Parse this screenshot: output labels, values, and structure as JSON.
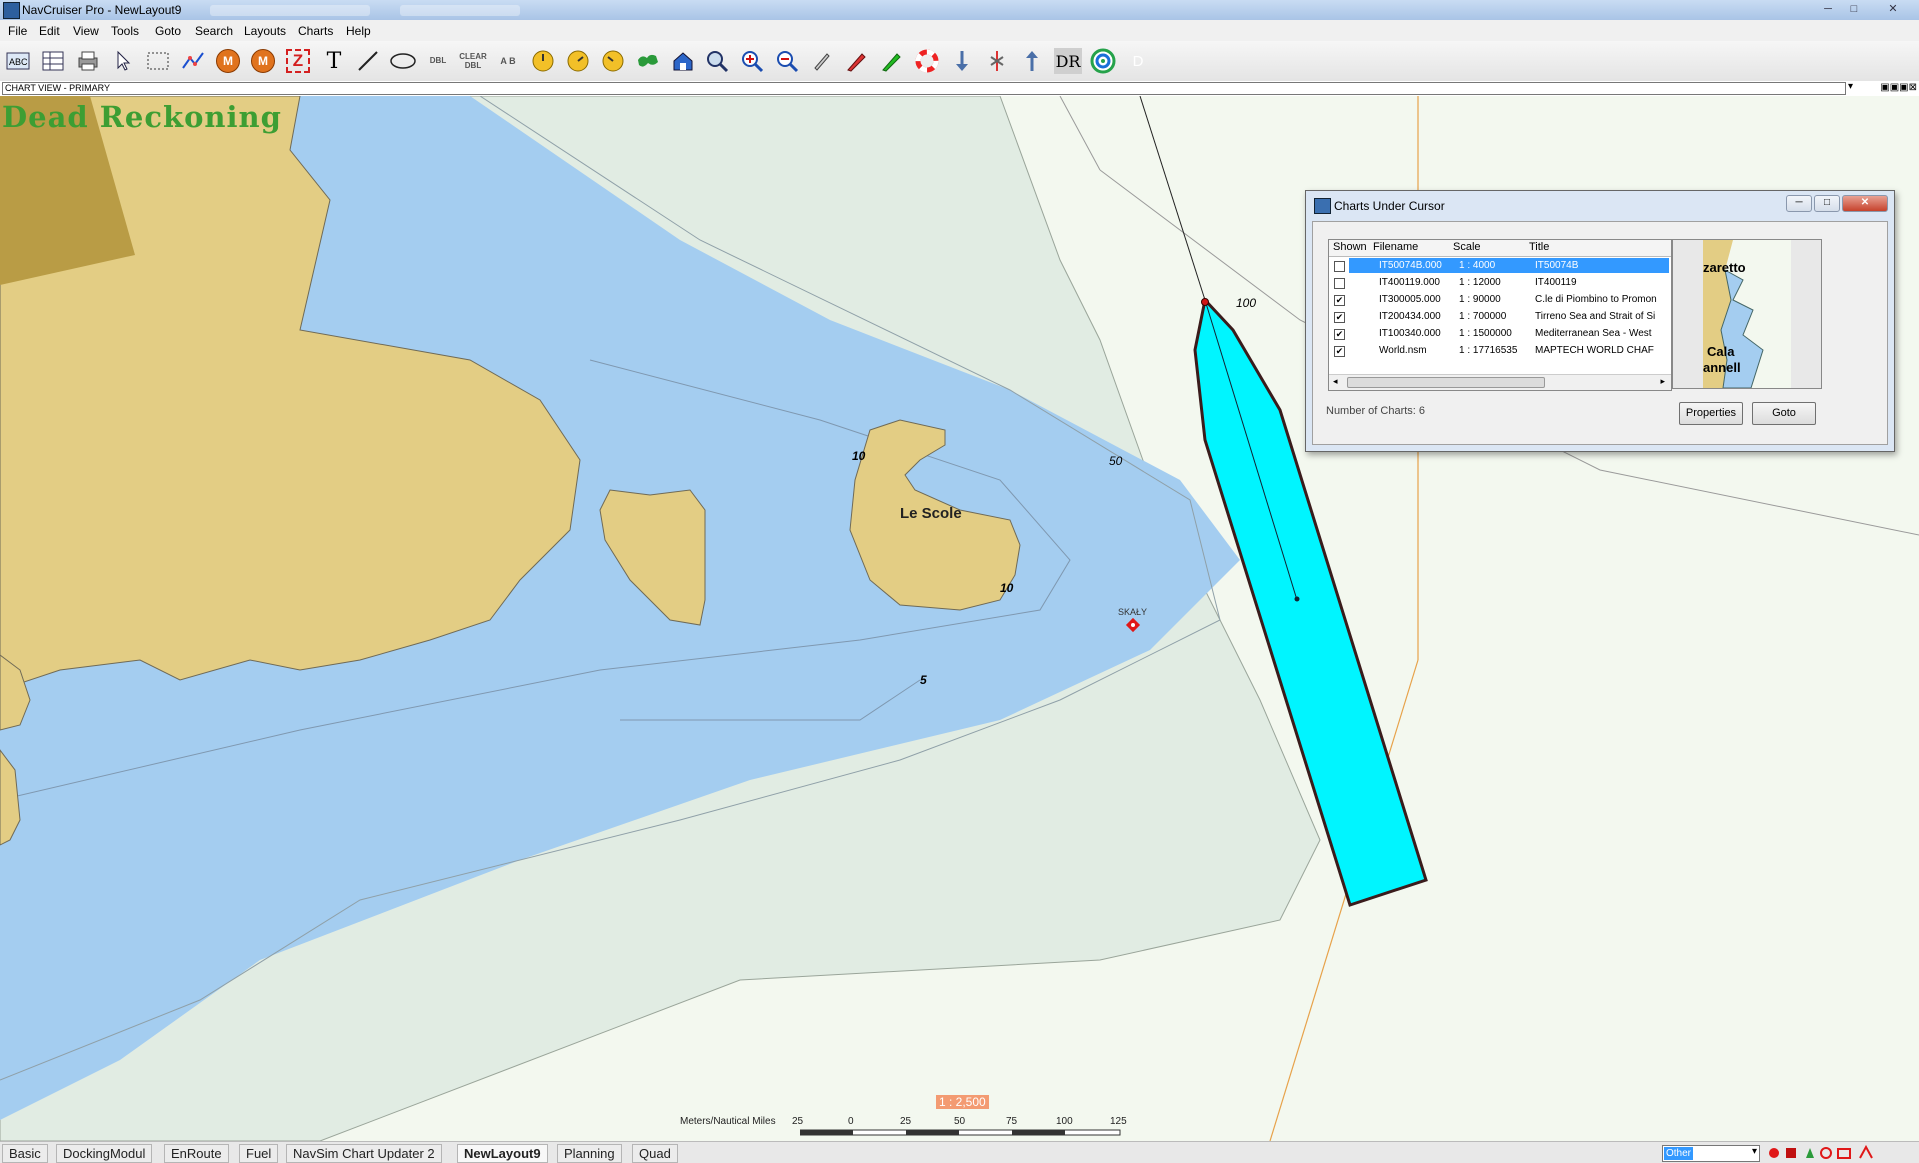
{
  "window": {
    "title": "NavCruiser Pro - NewLayout9",
    "controls": [
      "─",
      "□",
      "✕"
    ]
  },
  "menu": [
    "File",
    "Edit",
    "View",
    "Tools",
    "Goto",
    "Search",
    "Layouts",
    "Charts",
    "Help"
  ],
  "toolbar": {
    "m1": "M",
    "m2": "M",
    "z": "Z",
    "text_tool": "T",
    "dbl_label": "DBL",
    "clear_label": "CLEAR",
    "dbl2_label": "DBL",
    "ab_label": "A B",
    "dr_label": "DR",
    "d_label": "D"
  },
  "chart_view": {
    "label": "CHART VIEW - PRIMARY"
  },
  "map": {
    "mode_label": "Dead Reckoning",
    "island_label": "Le Scole",
    "rock_label": "SKAŁY",
    "depths": [
      "100",
      "50",
      "10",
      "10",
      "5"
    ],
    "scale_ratio": "1 : 2,500",
    "scale_units": "Meters/Nautical Miles",
    "scale_ticks": [
      "25",
      "0",
      "25",
      "50",
      "75",
      "100",
      "125"
    ]
  },
  "dialog": {
    "title": "Charts Under Cursor",
    "columns": [
      "Shown",
      "Filename",
      "Scale",
      "Title"
    ],
    "rows": [
      {
        "shown": false,
        "filename": "IT50074B.000",
        "scale": "1 : 4000",
        "title": "IT50074B"
      },
      {
        "shown": false,
        "filename": "IT400119.000",
        "scale": "1 : 12000",
        "title": "IT400119"
      },
      {
        "shown": true,
        "filename": "IT300005.000",
        "scale": "1 : 90000",
        "title": "C.le di Piombino to Promon"
      },
      {
        "shown": true,
        "filename": "IT200434.000",
        "scale": "1 : 700000",
        "title": "Tirreno Sea and Strait of Si"
      },
      {
        "shown": true,
        "filename": "IT100340.000",
        "scale": "1 : 1500000",
        "title": "Mediterranean Sea - West"
      },
      {
        "shown": true,
        "filename": "World.nsm",
        "scale": "1 : 17716535",
        "title": "MAPTECH WORLD CHAF"
      }
    ],
    "count_label": "Number of Charts:  6",
    "preview_text_1": "zaretto",
    "preview_text_2": "Cala",
    "preview_text_3": "annell",
    "properties_button": "Properties",
    "goto_button": "Goto"
  },
  "tabs": [
    "Basic",
    "DockingModul",
    "EnRoute",
    "Fuel",
    "NavSim Chart Updater 2",
    "NewLayout9",
    "Planning",
    "Quad"
  ],
  "active_tab": "NewLayout9",
  "status": {
    "dropdown_value": "Other"
  },
  "colors": {
    "land": "#e3cd84",
    "shallow": "#a4cdf0",
    "mid": "#e1ece3",
    "deep": "#f3f8ef",
    "vessel": "#00f5ff",
    "dr_text": "#3d9e33",
    "selection": "#3399ff"
  }
}
